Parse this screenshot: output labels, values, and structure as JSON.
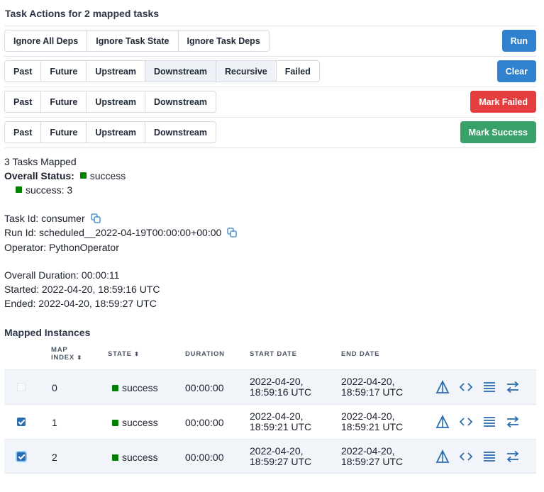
{
  "title": "Task Actions for 2 mapped tasks",
  "actions": {
    "run": {
      "options": [
        "Ignore All Deps",
        "Ignore Task State",
        "Ignore Task Deps"
      ],
      "button": "Run"
    },
    "clear": {
      "options": [
        "Past",
        "Future",
        "Upstream",
        "Downstream",
        "Recursive",
        "Failed"
      ],
      "active": [
        "Downstream",
        "Recursive"
      ],
      "button": "Clear"
    },
    "mark_failed": {
      "options": [
        "Past",
        "Future",
        "Upstream",
        "Downstream"
      ],
      "button": "Mark Failed"
    },
    "mark_success": {
      "options": [
        "Past",
        "Future",
        "Upstream",
        "Downstream"
      ],
      "button": "Mark Success"
    }
  },
  "summary": {
    "tasks_mapped": "3 Tasks Mapped",
    "overall_status_label": "Overall Status:",
    "overall_status_value": "success",
    "status_count": "success: 3"
  },
  "details": {
    "task_id": "Task Id: consumer",
    "run_id": "Run Id: scheduled__2022-04-19T00:00:00+00:00",
    "operator": "Operator: PythonOperator",
    "duration": "Overall Duration: 00:00:11",
    "started": "Started: 2022-04-20, 18:59:16 UTC",
    "ended": "Ended: 2022-04-20, 18:59:27 UTC"
  },
  "mapped_instances": {
    "title": "Mapped Instances",
    "columns": {
      "map_index_1": "MAP",
      "map_index_2": "INDEX",
      "state": "STATE",
      "duration": "DURATION",
      "start_date": "START DATE",
      "end_date": "END DATE"
    },
    "rows": [
      {
        "map_index": "0",
        "state": "success",
        "duration": "00:00:00",
        "start_1": "2022-04-20,",
        "start_2": "18:59:16 UTC",
        "end_1": "2022-04-20,",
        "end_2": "18:59:17 UTC",
        "checked": false
      },
      {
        "map_index": "1",
        "state": "success",
        "duration": "00:00:00",
        "start_1": "2022-04-20,",
        "start_2": "18:59:21 UTC",
        "end_1": "2022-04-20,",
        "end_2": "18:59:21 UTC",
        "checked": true
      },
      {
        "map_index": "2",
        "state": "success",
        "duration": "00:00:00",
        "start_1": "2022-04-20,",
        "start_2": "18:59:27 UTC",
        "end_1": "2022-04-20,",
        "end_2": "18:59:27 UTC",
        "checked": true
      }
    ],
    "row_icons": [
      "gantt-icon",
      "code-icon",
      "log-icon",
      "details-icon"
    ]
  },
  "colors": {
    "primary": "#3182ce",
    "danger": "#e53e3e",
    "success_button": "#38a169",
    "success_state": "#008000",
    "icon": "#2b6cb0"
  }
}
